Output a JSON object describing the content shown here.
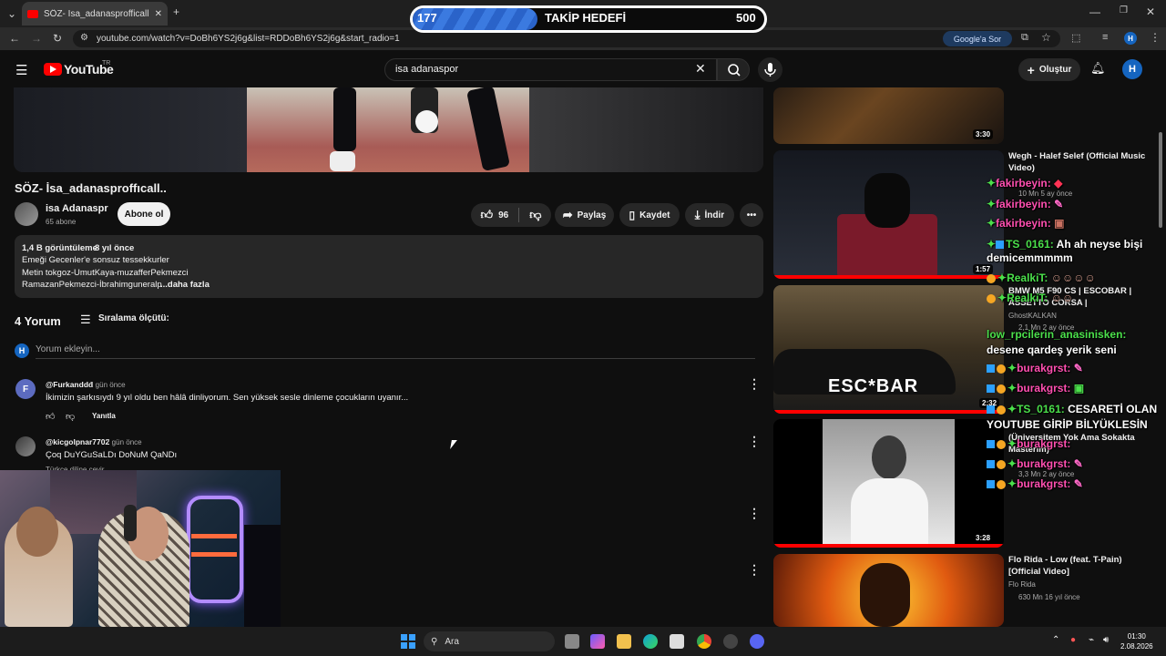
{
  "browser": {
    "tab_title": "SÖZ- İsa_adanasprofficall.. - Yo",
    "new_tab": "+",
    "url": "youtube.com/watch?v=DoBh6YS2j6g&list=RDDoBh6YS2j6g&start_radio=1",
    "google_button": "Google'a Sor"
  },
  "overlay": {
    "goal_current": "177",
    "goal_label": "TAKİP HEDEFİ",
    "goal_max": "500",
    "goal_progress": 0.354
  },
  "youtube": {
    "logo": "YouTube",
    "logo_region": "TR",
    "search_query": "isa adanaspor",
    "create_label": "Oluştur",
    "avatar_letter": "H"
  },
  "video": {
    "title": "SÖZ- İsa_adanasproffıcall..",
    "channel": "isa Adanaspr",
    "subscribers": "65 abone",
    "subscribe_label": "Abone ol",
    "likes": "96",
    "share_label": "Paylaş",
    "save_label": "Kaydet",
    "download_label": "İndir",
    "description": {
      "views": "1,4 B görüntüleme",
      "age": "8 yıl önce",
      "line1": "Emeği Gecenler'e sonsuz tessekkurler",
      "line2": "Metin tokgoz-UmutKaya-muzafferPekmezci",
      "line3": "RamazanPekmezci-İbrahimguneralp",
      "more": "...daha fazla"
    }
  },
  "comments": {
    "count_label": "4 Yorum",
    "sort_label": "Sıralama ölçütü:",
    "add_placeholder": "Yorum ekleyin...",
    "items": [
      {
        "user": "@Furkanddd",
        "time": "1 gün önce",
        "text": "İkimizin şarkısıydı 9 yıl oldu ben hâlâ dinliyorum. Sen yüksek sesle dinleme çocukların uyanır...",
        "avatar_letter": "F",
        "reply_label": "Yanıtla"
      },
      {
        "user": "@kicgolpnar7702",
        "time": "7 gün önce",
        "text": "Çoq DuYGuSaLDı DoNuM QaNDı",
        "translate": "Türkçe diline çevir"
      }
    ]
  },
  "sidebar": {
    "items": [
      {
        "duration": "3:30"
      },
      {
        "title": "Wegh - Halef Selef (Official Music Video)",
        "channel": "",
        "meta": "10 Mn  5 ay önce",
        "duration": "1:57"
      },
      {
        "title": "BMW M5 F90 CS | ESCOBAR | ASSETTO CORSA |",
        "channel": "GhostKALKAN",
        "meta": "2,1 Mn  2 ay önce",
        "duration": "2:32",
        "thumb_text": "ESC*BAR"
      },
      {
        "title": "(Üniversitem Yok Ama Sokakta Masterım)",
        "channel": "",
        "meta": "3,3 Mn  2 ay önce",
        "duration": "3:28"
      },
      {
        "title": "Flo Rida - Low (feat. T-Pain) [Official Video]",
        "channel": "Flo Rida",
        "meta": "630 Mn  16 yıl önce"
      }
    ]
  },
  "chat": [
    {
      "user": "fakirbeyin:",
      "msg": "",
      "color": "#ff4fb0"
    },
    {
      "user": "fakirbeyin:",
      "msg": "",
      "color": "#ff4fb0"
    },
    {
      "user": "fakirbeyin:",
      "msg": "",
      "color": "#ff4fb0"
    },
    {
      "user": "TS_0161:",
      "msg": "Ah ah neyse bişi demicemmmmm",
      "color": "#4be04b"
    },
    {
      "user": "RealkiT:",
      "msg": "",
      "color": "#4be04b"
    },
    {
      "user": "RealkiT:",
      "msg": "",
      "color": "#4be04b"
    },
    {
      "user": "low_rpcilerin_anasinisken:",
      "msg": "desene qardeş yerik seni",
      "color": "#4be04b"
    },
    {
      "user": "burakgrst:",
      "msg": "",
      "color": "#ff4fb0"
    },
    {
      "user": "burakgrst:",
      "msg": "",
      "color": "#ff4fb0"
    },
    {
      "user": "TS_0161:",
      "msg": "CESARETİ OLAN YOUTUBE GİRİP BİLYÜKLESİN",
      "color": "#4be04b"
    },
    {
      "user": "burakgrst:",
      "msg": "",
      "color": "#ff4fb0"
    },
    {
      "user": "burakgrst:",
      "msg": "",
      "color": "#ff4fb0"
    },
    {
      "user": "burakgrst:",
      "msg": "",
      "color": "#ff4fb0"
    }
  ],
  "taskbar": {
    "search_label": "Ara",
    "time": "01:30",
    "date": "2.08.2026"
  }
}
